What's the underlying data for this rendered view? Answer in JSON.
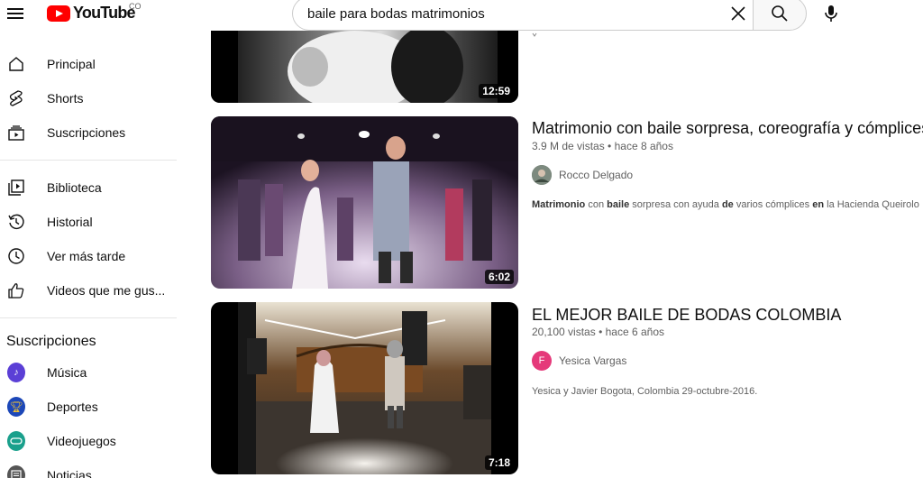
{
  "header": {
    "logo_text": "YouTube",
    "country_code": "CO",
    "search_value": "baile para bodas matrimonios"
  },
  "sidebar": {
    "primary": [
      {
        "label": "Principal",
        "icon": "home-icon"
      },
      {
        "label": "Shorts",
        "icon": "shorts-icon"
      },
      {
        "label": "Suscripciones",
        "icon": "subscriptions-icon"
      }
    ],
    "library": [
      {
        "label": "Biblioteca",
        "icon": "library-icon"
      },
      {
        "label": "Historial",
        "icon": "history-icon"
      },
      {
        "label": "Ver más tarde",
        "icon": "watch-later-icon"
      },
      {
        "label": "Videos que me gus...",
        "icon": "liked-icon"
      }
    ],
    "subscriptions_title": "Suscripciones",
    "subscriptions": [
      {
        "label": "Música",
        "icon": "music-icon",
        "color": "#5b3fd6"
      },
      {
        "label": "Deportes",
        "icon": "sports-icon",
        "color": "#1c47b8"
      },
      {
        "label": "Videojuegos",
        "icon": "gaming-icon",
        "color": "#1aa08c"
      },
      {
        "label": "Noticias",
        "icon": "news-icon",
        "color": "#555555"
      }
    ]
  },
  "results": [
    {
      "duration": "12:59"
    },
    {
      "title": "Matrimonio con baile sorpresa, coreografía y cómplices",
      "views": "3.9 M de vistas",
      "age": "hace 8 años",
      "channel": "Rocco Delgado",
      "desc_parts": [
        {
          "t": "Matrimonio",
          "b": true
        },
        {
          "t": " con ",
          "b": false
        },
        {
          "t": "baile",
          "b": true
        },
        {
          "t": " sorpresa con ayuda ",
          "b": false
        },
        {
          "t": "de",
          "b": true
        },
        {
          "t": " varios cómplices ",
          "b": false
        },
        {
          "t": "en",
          "b": true
        },
        {
          "t": " la Hacienda Queirolo",
          "b": false
        }
      ],
      "duration": "6:02"
    },
    {
      "title": "EL MEJOR BAILE DE BODAS COLOMBIA",
      "views": "20,100 vistas",
      "age": "hace 6 años",
      "channel": "Yesica Vargas",
      "channel_initial": "F",
      "channel_color": "#e5397a",
      "description": "Yesica y Javier Bogota, Colombia 29-octubre-2016.",
      "duration": "7:18"
    }
  ]
}
